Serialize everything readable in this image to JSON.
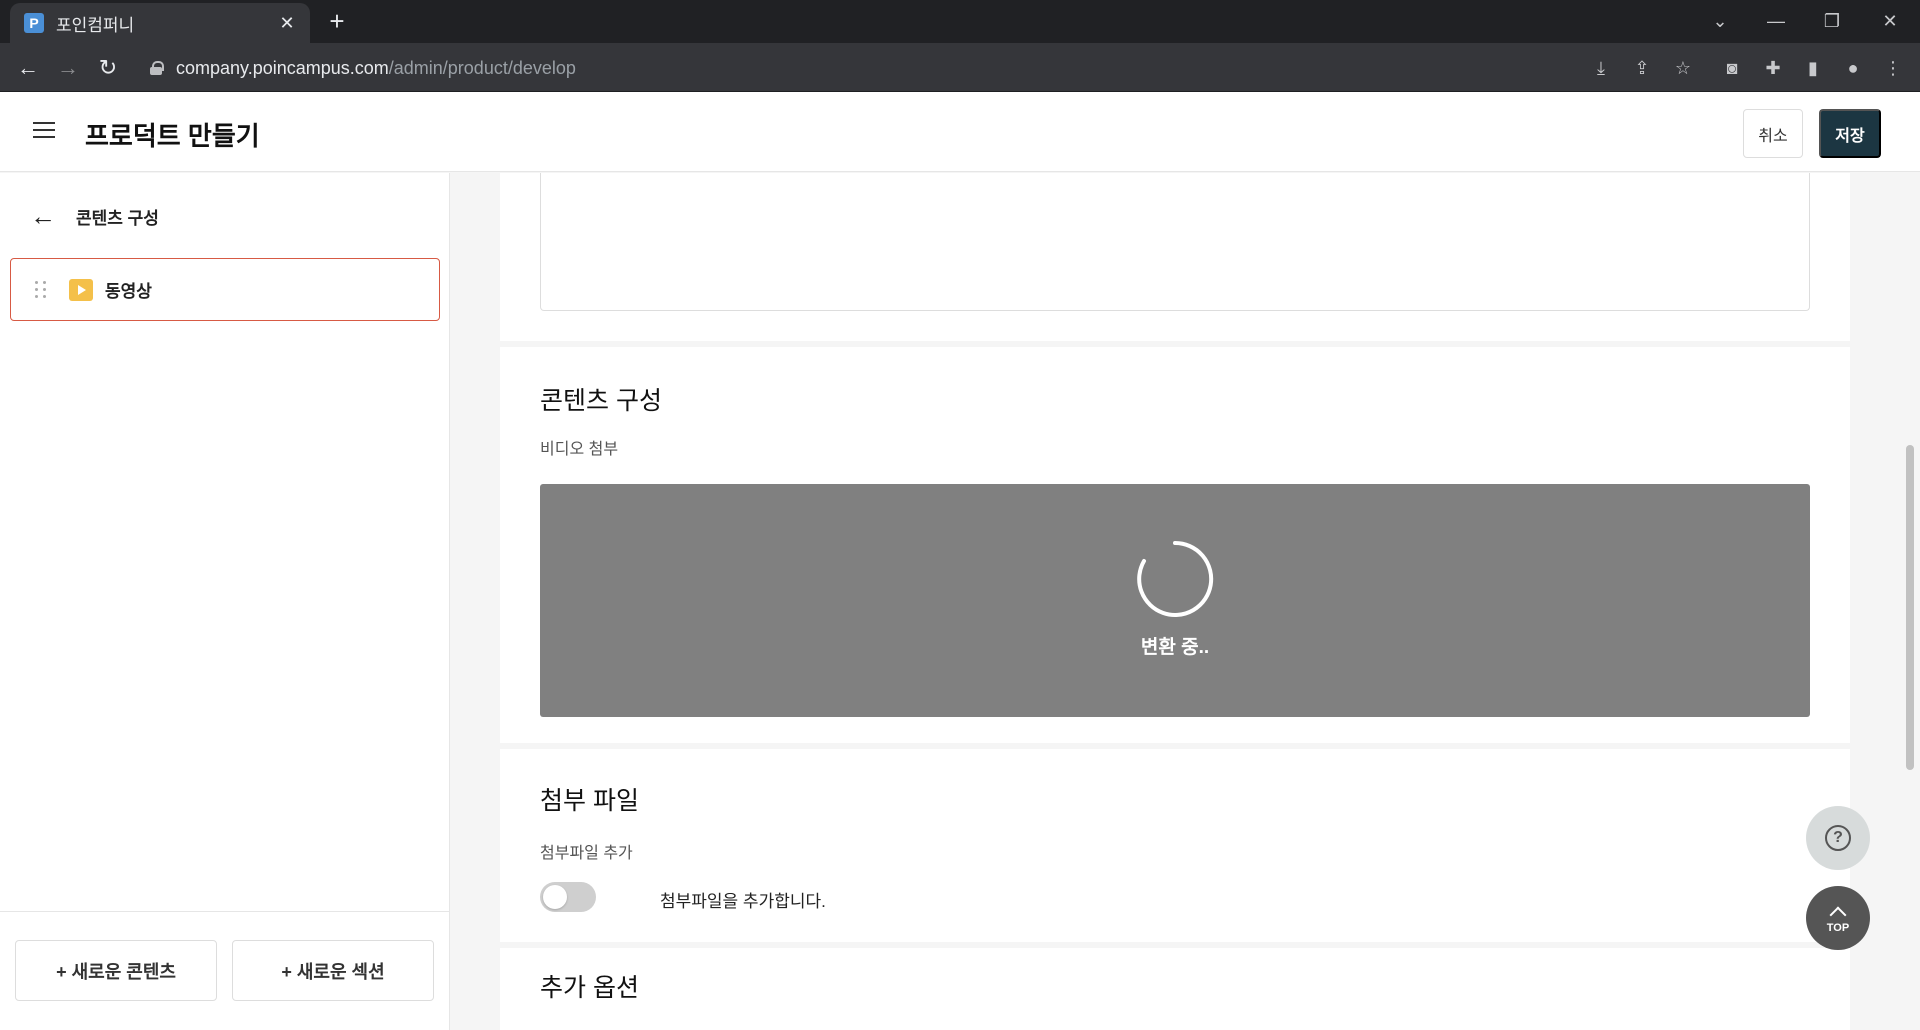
{
  "browser": {
    "tab_title": "포인컴퍼니",
    "favicon_letter": "P",
    "url_host": "company.poincampus.com",
    "url_path": "/admin/product/develop"
  },
  "header": {
    "title": "프로덕트 만들기",
    "cancel_label": "취소",
    "save_label": "저장"
  },
  "sidebar": {
    "back_label": "콘텐츠 구성",
    "items": [
      {
        "label": "동영상",
        "icon": "video-icon"
      }
    ],
    "new_content_label": "+ 새로운 콘텐츠",
    "new_section_label": "+ 새로운 섹션"
  },
  "main": {
    "content_section": {
      "title": "콘텐츠 구성",
      "video_label": "비디오 첨부",
      "status": "변환 중.."
    },
    "attachment_section": {
      "title": "첨부 파일",
      "field_label": "첨부파일 추가",
      "toggle_label": "첨부파일을 추가합니다.",
      "toggle_on": false
    },
    "options_section": {
      "title": "추가 옵션"
    }
  },
  "floating": {
    "help_icon": "question-circle-icon",
    "top_label": "TOP"
  },
  "colors": {
    "brand_dark": "#1c3642",
    "selected_border": "#d75a44",
    "video_icon": "#f4c04a",
    "video_placeholder": "#808080"
  }
}
